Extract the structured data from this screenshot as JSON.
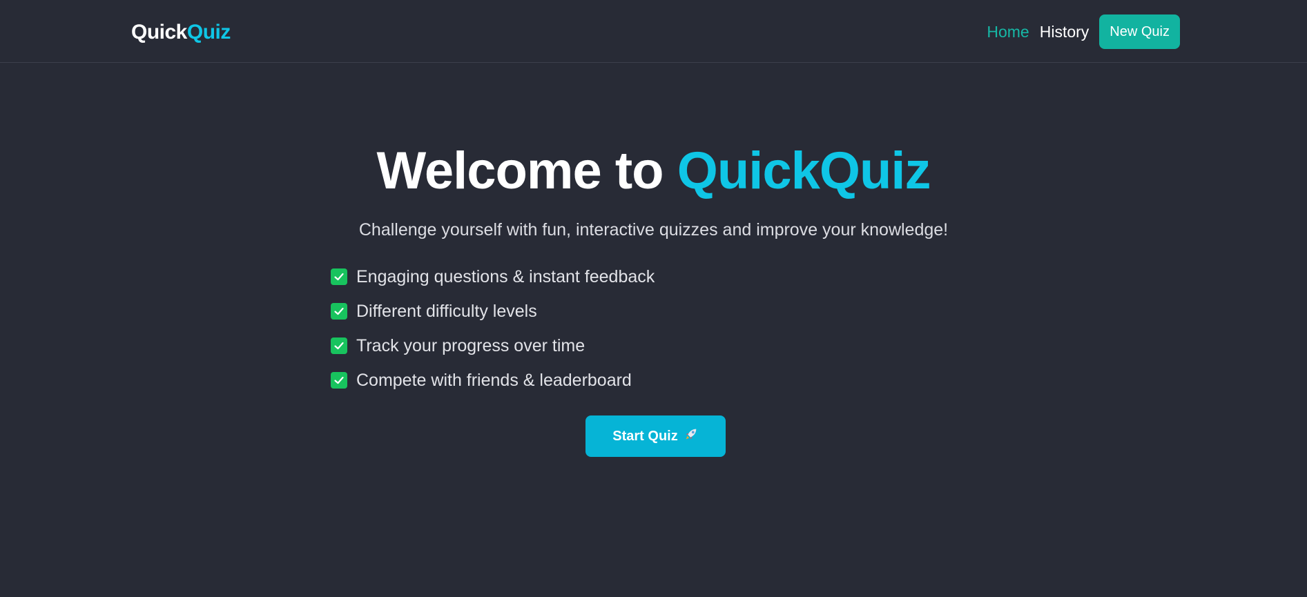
{
  "navbar": {
    "brand_part1": "Quick",
    "brand_part2": "Quiz",
    "links": [
      {
        "label": "Home"
      },
      {
        "label": "History"
      }
    ],
    "new_quiz_label": "New Quiz"
  },
  "hero": {
    "title_prefix": "Welcome to ",
    "title_highlight": "QuickQuiz",
    "subtitle": "Challenge yourself with fun, interactive quizzes and improve your knowledge!",
    "features": [
      "Engaging questions & instant feedback",
      "Different difficulty levels",
      "Track your progress over time",
      "Compete with friends & leaderboard"
    ],
    "start_label": "Start Quiz",
    "start_icon": "rocket-icon"
  },
  "colors": {
    "background": "#282b36",
    "accent_cyan": "#0fc6e6",
    "accent_teal": "#12b3a0",
    "check_green": "#18c35e"
  }
}
